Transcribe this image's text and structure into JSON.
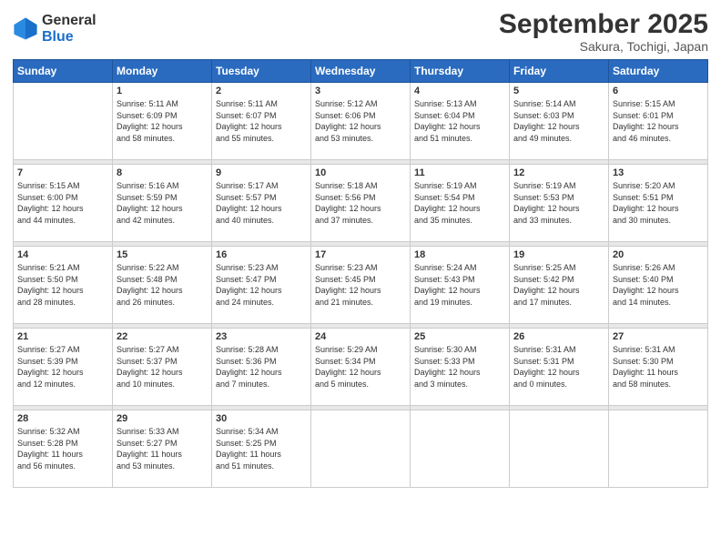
{
  "header": {
    "logo_general": "General",
    "logo_blue": "Blue",
    "month": "September 2025",
    "location": "Sakura, Tochigi, Japan"
  },
  "weekdays": [
    "Sunday",
    "Monday",
    "Tuesday",
    "Wednesday",
    "Thursday",
    "Friday",
    "Saturday"
  ],
  "weeks": [
    [
      {
        "day": "",
        "info": ""
      },
      {
        "day": "1",
        "info": "Sunrise: 5:11 AM\nSunset: 6:09 PM\nDaylight: 12 hours\nand 58 minutes."
      },
      {
        "day": "2",
        "info": "Sunrise: 5:11 AM\nSunset: 6:07 PM\nDaylight: 12 hours\nand 55 minutes."
      },
      {
        "day": "3",
        "info": "Sunrise: 5:12 AM\nSunset: 6:06 PM\nDaylight: 12 hours\nand 53 minutes."
      },
      {
        "day": "4",
        "info": "Sunrise: 5:13 AM\nSunset: 6:04 PM\nDaylight: 12 hours\nand 51 minutes."
      },
      {
        "day": "5",
        "info": "Sunrise: 5:14 AM\nSunset: 6:03 PM\nDaylight: 12 hours\nand 49 minutes."
      },
      {
        "day": "6",
        "info": "Sunrise: 5:15 AM\nSunset: 6:01 PM\nDaylight: 12 hours\nand 46 minutes."
      }
    ],
    [
      {
        "day": "7",
        "info": "Sunrise: 5:15 AM\nSunset: 6:00 PM\nDaylight: 12 hours\nand 44 minutes."
      },
      {
        "day": "8",
        "info": "Sunrise: 5:16 AM\nSunset: 5:59 PM\nDaylight: 12 hours\nand 42 minutes."
      },
      {
        "day": "9",
        "info": "Sunrise: 5:17 AM\nSunset: 5:57 PM\nDaylight: 12 hours\nand 40 minutes."
      },
      {
        "day": "10",
        "info": "Sunrise: 5:18 AM\nSunset: 5:56 PM\nDaylight: 12 hours\nand 37 minutes."
      },
      {
        "day": "11",
        "info": "Sunrise: 5:19 AM\nSunset: 5:54 PM\nDaylight: 12 hours\nand 35 minutes."
      },
      {
        "day": "12",
        "info": "Sunrise: 5:19 AM\nSunset: 5:53 PM\nDaylight: 12 hours\nand 33 minutes."
      },
      {
        "day": "13",
        "info": "Sunrise: 5:20 AM\nSunset: 5:51 PM\nDaylight: 12 hours\nand 30 minutes."
      }
    ],
    [
      {
        "day": "14",
        "info": "Sunrise: 5:21 AM\nSunset: 5:50 PM\nDaylight: 12 hours\nand 28 minutes."
      },
      {
        "day": "15",
        "info": "Sunrise: 5:22 AM\nSunset: 5:48 PM\nDaylight: 12 hours\nand 26 minutes."
      },
      {
        "day": "16",
        "info": "Sunrise: 5:23 AM\nSunset: 5:47 PM\nDaylight: 12 hours\nand 24 minutes."
      },
      {
        "day": "17",
        "info": "Sunrise: 5:23 AM\nSunset: 5:45 PM\nDaylight: 12 hours\nand 21 minutes."
      },
      {
        "day": "18",
        "info": "Sunrise: 5:24 AM\nSunset: 5:43 PM\nDaylight: 12 hours\nand 19 minutes."
      },
      {
        "day": "19",
        "info": "Sunrise: 5:25 AM\nSunset: 5:42 PM\nDaylight: 12 hours\nand 17 minutes."
      },
      {
        "day": "20",
        "info": "Sunrise: 5:26 AM\nSunset: 5:40 PM\nDaylight: 12 hours\nand 14 minutes."
      }
    ],
    [
      {
        "day": "21",
        "info": "Sunrise: 5:27 AM\nSunset: 5:39 PM\nDaylight: 12 hours\nand 12 minutes."
      },
      {
        "day": "22",
        "info": "Sunrise: 5:27 AM\nSunset: 5:37 PM\nDaylight: 12 hours\nand 10 minutes."
      },
      {
        "day": "23",
        "info": "Sunrise: 5:28 AM\nSunset: 5:36 PM\nDaylight: 12 hours\nand 7 minutes."
      },
      {
        "day": "24",
        "info": "Sunrise: 5:29 AM\nSunset: 5:34 PM\nDaylight: 12 hours\nand 5 minutes."
      },
      {
        "day": "25",
        "info": "Sunrise: 5:30 AM\nSunset: 5:33 PM\nDaylight: 12 hours\nand 3 minutes."
      },
      {
        "day": "26",
        "info": "Sunrise: 5:31 AM\nSunset: 5:31 PM\nDaylight: 12 hours\nand 0 minutes."
      },
      {
        "day": "27",
        "info": "Sunrise: 5:31 AM\nSunset: 5:30 PM\nDaylight: 11 hours\nand 58 minutes."
      }
    ],
    [
      {
        "day": "28",
        "info": "Sunrise: 5:32 AM\nSunset: 5:28 PM\nDaylight: 11 hours\nand 56 minutes."
      },
      {
        "day": "29",
        "info": "Sunrise: 5:33 AM\nSunset: 5:27 PM\nDaylight: 11 hours\nand 53 minutes."
      },
      {
        "day": "30",
        "info": "Sunrise: 5:34 AM\nSunset: 5:25 PM\nDaylight: 11 hours\nand 51 minutes."
      },
      {
        "day": "",
        "info": ""
      },
      {
        "day": "",
        "info": ""
      },
      {
        "day": "",
        "info": ""
      },
      {
        "day": "",
        "info": ""
      }
    ]
  ]
}
